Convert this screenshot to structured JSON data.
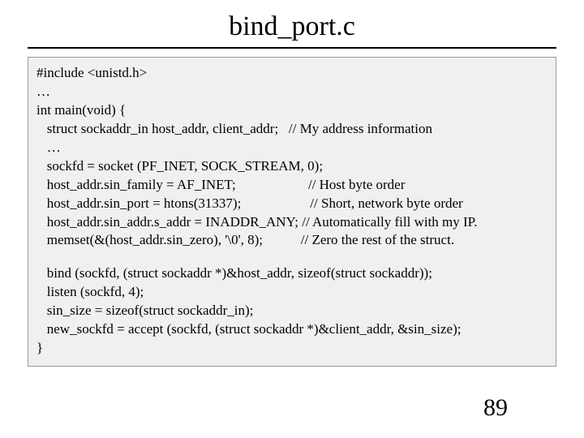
{
  "title": "bind_port.c",
  "code": {
    "l1": "#include <unistd.h>",
    "l2": "…",
    "l3": "int main(void) {",
    "l4": "   struct sockaddr_in host_addr, client_addr;   // My address information",
    "l5": "   …",
    "l6": "   sockfd = socket (PF_INET, SOCK_STREAM, 0);",
    "l7": "   host_addr.sin_family = AF_INET;                     // Host byte order",
    "l8": "   host_addr.sin_port = htons(31337);                    // Short, network byte order",
    "l9": "   host_addr.sin_addr.s_addr = INADDR_ANY; // Automatically fill with my IP.",
    "l10": "   memset(&(host_addr.sin_zero), '\\0', 8);           // Zero the rest of the struct.",
    "l11": "   bind (sockfd, (struct sockaddr *)&host_addr, sizeof(struct sockaddr));",
    "l12": "   listen (sockfd, 4);",
    "l13": "   sin_size = sizeof(struct sockaddr_in);",
    "l14": "   new_sockfd = accept (sockfd, (struct sockaddr *)&client_addr, &sin_size);",
    "l15": "}"
  },
  "page_number": "89"
}
